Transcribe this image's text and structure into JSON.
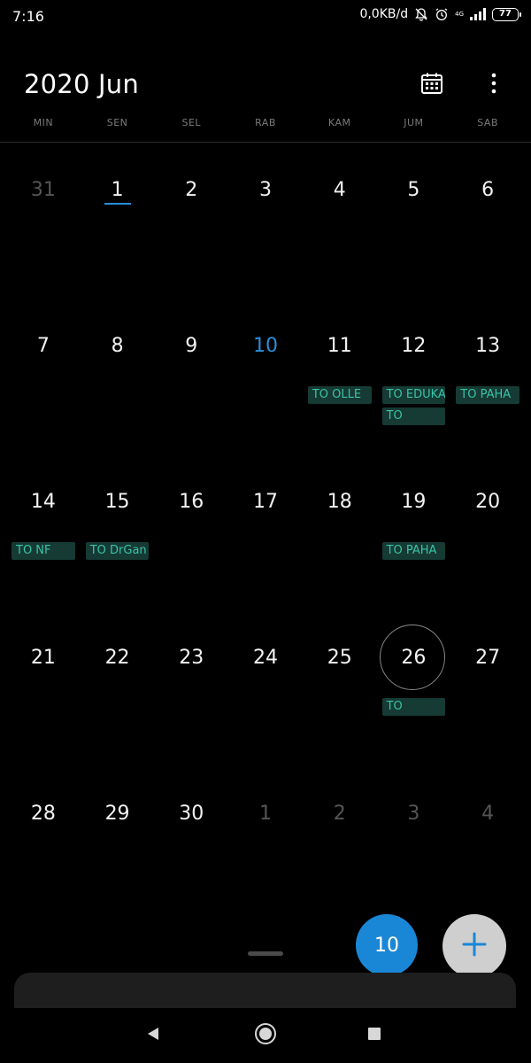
{
  "status_bar": {
    "time": "7:16",
    "speed": "0,0KB/d",
    "network": "4G",
    "battery": "77"
  },
  "header": {
    "title": "2020 Jun",
    "calendar_icon": "calendar-icon",
    "more_icon": "more-vertical-icon"
  },
  "weekdays": [
    "MIN",
    "SEN",
    "SEL",
    "RAB",
    "KAM",
    "JUM",
    "SAB"
  ],
  "days": [
    {
      "label": "31",
      "muted": true
    },
    {
      "label": "1",
      "underline": true
    },
    {
      "label": "2"
    },
    {
      "label": "3"
    },
    {
      "label": "4"
    },
    {
      "label": "5"
    },
    {
      "label": "6"
    },
    {
      "label": "7"
    },
    {
      "label": "8"
    },
    {
      "label": "9"
    },
    {
      "label": "10",
      "selected": true
    },
    {
      "label": "11",
      "events": [
        "TO OLLE"
      ]
    },
    {
      "label": "12",
      "events": [
        "TO EDUKA",
        "TO"
      ]
    },
    {
      "label": "13",
      "events": [
        "TO PAHA"
      ]
    },
    {
      "label": "14",
      "events": [
        "TO NF"
      ]
    },
    {
      "label": "15",
      "events": [
        "TO DrGan"
      ]
    },
    {
      "label": "16"
    },
    {
      "label": "17"
    },
    {
      "label": "18"
    },
    {
      "label": "19",
      "events": [
        "TO PAHA"
      ]
    },
    {
      "label": "20"
    },
    {
      "label": "21"
    },
    {
      "label": "22"
    },
    {
      "label": "23"
    },
    {
      "label": "24"
    },
    {
      "label": "25"
    },
    {
      "label": "26",
      "today_ring": true,
      "events": [
        "TO"
      ]
    },
    {
      "label": "27"
    },
    {
      "label": "28"
    },
    {
      "label": "29"
    },
    {
      "label": "30"
    },
    {
      "label": "1",
      "muted": true
    },
    {
      "label": "2",
      "muted": true
    },
    {
      "label": "3",
      "muted": true
    },
    {
      "label": "4",
      "muted": true
    }
  ],
  "fab": {
    "today_label": "10",
    "add_icon": "plus-icon"
  },
  "navbar": {
    "back_icon": "back-triangle-icon",
    "home_icon": "home-circle-icon",
    "recents_icon": "recents-square-icon"
  },
  "colors": {
    "accent": "#2a8ed8",
    "event_bg": "#163a34",
    "event_text": "#39c4a7"
  }
}
